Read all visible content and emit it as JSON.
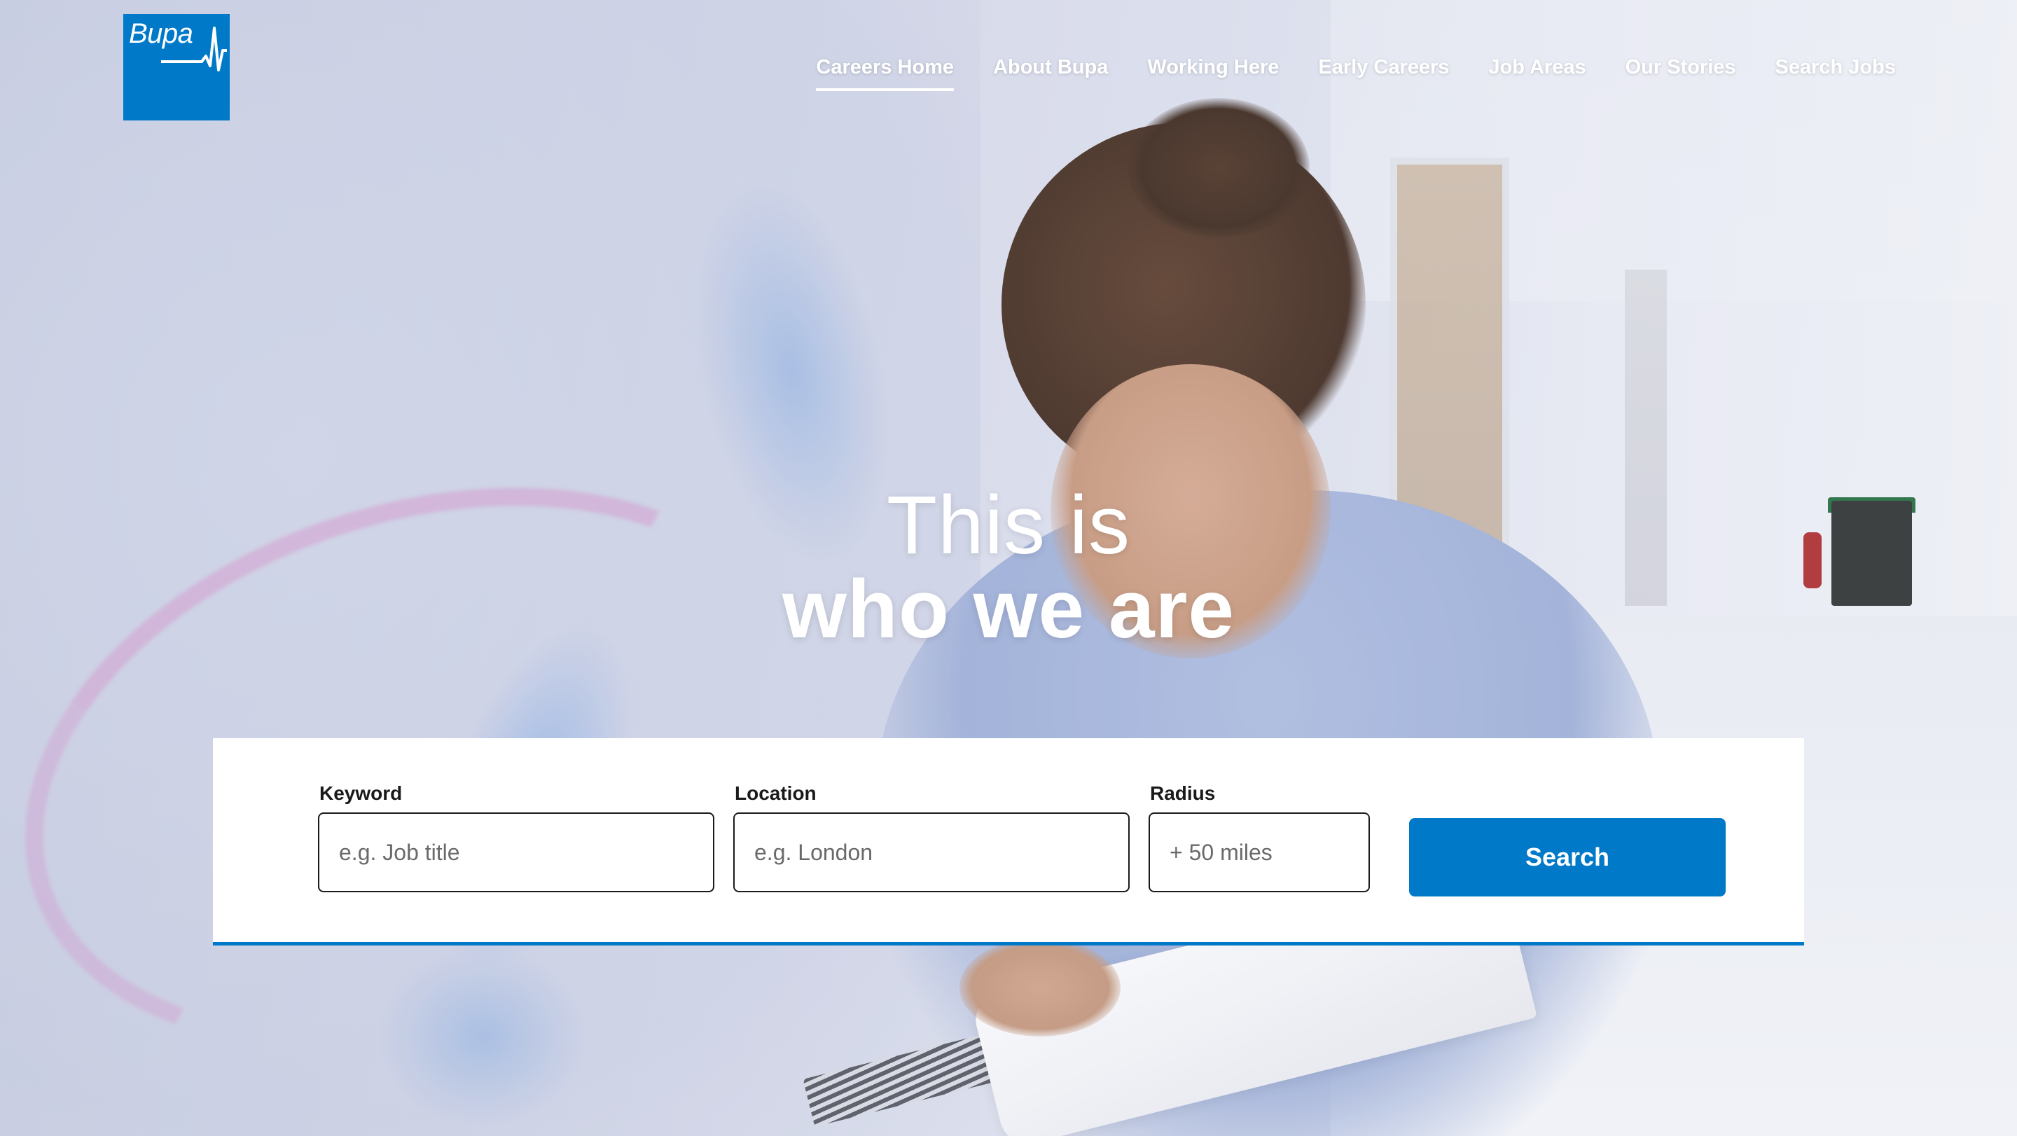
{
  "brand": {
    "logo_text": "Bupa",
    "color": "#0079c8"
  },
  "nav": {
    "items": [
      {
        "label": "Careers Home",
        "active": true
      },
      {
        "label": "About Bupa",
        "active": false
      },
      {
        "label": "Working Here",
        "active": false
      },
      {
        "label": "Early Careers",
        "active": false
      },
      {
        "label": "Job Areas",
        "active": false
      },
      {
        "label": "Our Stories",
        "active": false
      },
      {
        "label": "Search Jobs",
        "active": false
      }
    ]
  },
  "hero": {
    "line1": "This is",
    "line2": "who we are"
  },
  "search": {
    "keyword": {
      "label": "Keyword",
      "placeholder": "e.g. Job title",
      "value": ""
    },
    "location": {
      "label": "Location",
      "placeholder": "e.g. London",
      "value": ""
    },
    "radius": {
      "label": "Radius",
      "placeholder": "+ 50 miles",
      "value": ""
    },
    "button_label": "Search"
  }
}
